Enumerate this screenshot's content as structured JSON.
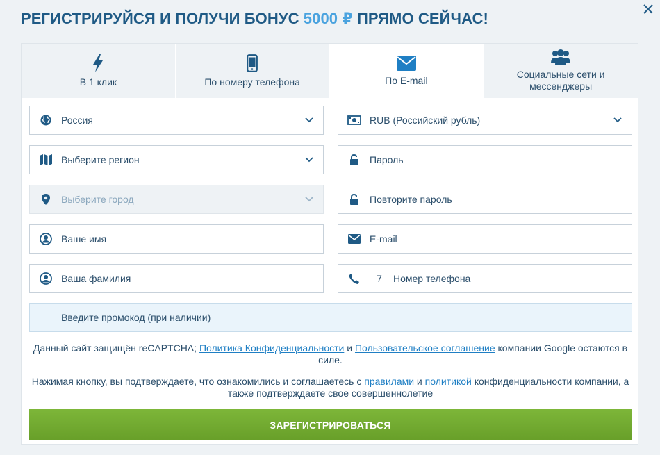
{
  "heading": {
    "prefix": "РЕГИСТРИРУЙСЯ И ПОЛУЧИ БОНУС ",
    "amount": "5000 ₽",
    "suffix": " ПРЯМО СЕЙЧАС!"
  },
  "tabs": [
    {
      "label": "В 1 клик",
      "icon": "lightning-icon"
    },
    {
      "label": "По номеру телефона",
      "icon": "smartphone-icon"
    },
    {
      "label": "По E-mail",
      "icon": "envelope-icon",
      "active": true
    },
    {
      "label": "Социальные сети и мессенджеры",
      "icon": "users-icon"
    }
  ],
  "fields": {
    "country": "Россия",
    "currency": "RUB (Российский рубль)",
    "region": "Выберите регион",
    "password": "Пароль",
    "city": "Выберите город",
    "password_repeat": "Повторите пароль",
    "first_name": "Ваше имя",
    "email": "E-mail",
    "last_name": "Ваша фамилия",
    "phone_code": "7",
    "phone": "Номер телефона",
    "promo": "Введите промокод (при наличии)"
  },
  "recaptcha": {
    "text1": "Данный сайт защищён reCAPTCHA; ",
    "privacy_link": "Политика Конфиденциальности",
    "and": " и ",
    "terms_link": "Пользовательское соглашение",
    "text2": " компании Google остаются в силе."
  },
  "consent": {
    "text1": "Нажимая кнопку, вы подтверждаете, что ознакомились и соглашаетесь с ",
    "rules_link": "правилами",
    "and": " и ",
    "policy_link": "политикой",
    "text2": " конфиденциальности компании, а также подтверждаете свое совершеннолетие"
  },
  "submit_label": "ЗАРЕГИСТРИРОВАТЬСЯ",
  "colors": {
    "brand": "#1f5a85",
    "accent": "#4aa3df",
    "button": "#74ab31",
    "link": "#1f7fc4"
  }
}
